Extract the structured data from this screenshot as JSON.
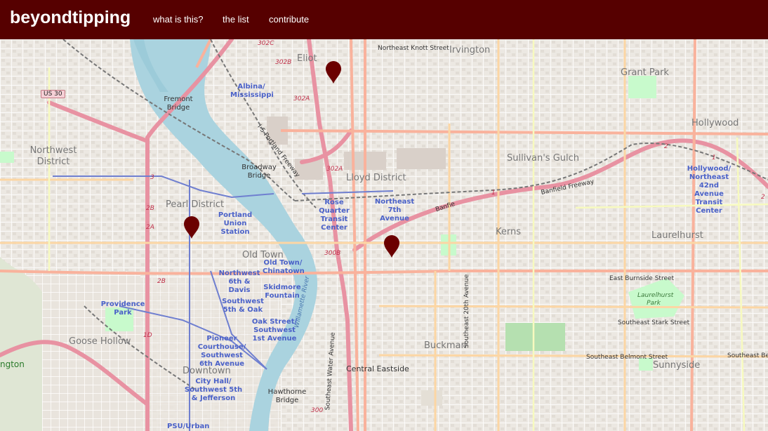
{
  "nav": {
    "brand": "beyondtipping",
    "links": [
      "what is this?",
      "the list",
      "contribute"
    ]
  },
  "map": {
    "places": [
      "Irvington",
      "Grant Park",
      "Eliot",
      "Hollywood",
      "Northwest District",
      "Sullivan's Gulch",
      "Lloyd District",
      "Pearl District",
      "Kerns",
      "Laurelhurst",
      "Old Town",
      "Goose Hollow",
      "Downtown",
      "Buckman",
      "Sunnyside",
      "Central Eastside"
    ],
    "streets": [
      "Northeast Knott Street",
      "Banfield Freeway",
      "East Burnside Street",
      "Southeast Stark Street",
      "Southeast Belmont Street",
      "Southeast Belm",
      "Southeast 20th Avenue",
      "Southeast Water Avenue",
      "Willamette River",
      "I-5 Portland Freeway",
      "Banfie",
      "Laurelhurst Park"
    ],
    "transit": [
      "Albina/ Mississippi",
      "Rose Quarter Transit Center",
      "Northeast 7th Avenue",
      "Hollywood/ Northeast 42nd Avenue Transit Center",
      "Portland Union Station",
      "Old Town/ Chinatown",
      "Northwest 6th & Davis",
      "Skidmore Fountain",
      "Providence Park",
      "Southwest 5th & Oak",
      "Oak Street/ Southwest 1st Avenue",
      "Pioneer Courthouse/ Southwest 6th Avenue",
      "City Hall/ Southwest 5th & Jefferson",
      "PSU/Urban"
    ],
    "bridges": [
      "Fremont Bridge",
      "Broadway Bridge",
      "Hawthorne Bridge"
    ],
    "shields": [
      "US 30"
    ],
    "route_numbers": [
      "302B",
      "302C",
      "302A",
      "302A",
      "300B",
      "2B",
      "2A",
      "2B",
      "1D",
      "3",
      "2",
      "1",
      "2",
      "1",
      "300"
    ],
    "edge_labels": [
      "ngton"
    ],
    "markers": [
      {
        "name": "marker-eliot"
      },
      {
        "name": "marker-pearl"
      },
      {
        "name": "marker-kerns"
      }
    ],
    "colors": {
      "motorway": "#e892a2",
      "trunk": "#f9b29c",
      "primary": "#fcd6a4",
      "water": "#aad3df",
      "park": "#c8facc",
      "marker": "#6b0000"
    }
  }
}
